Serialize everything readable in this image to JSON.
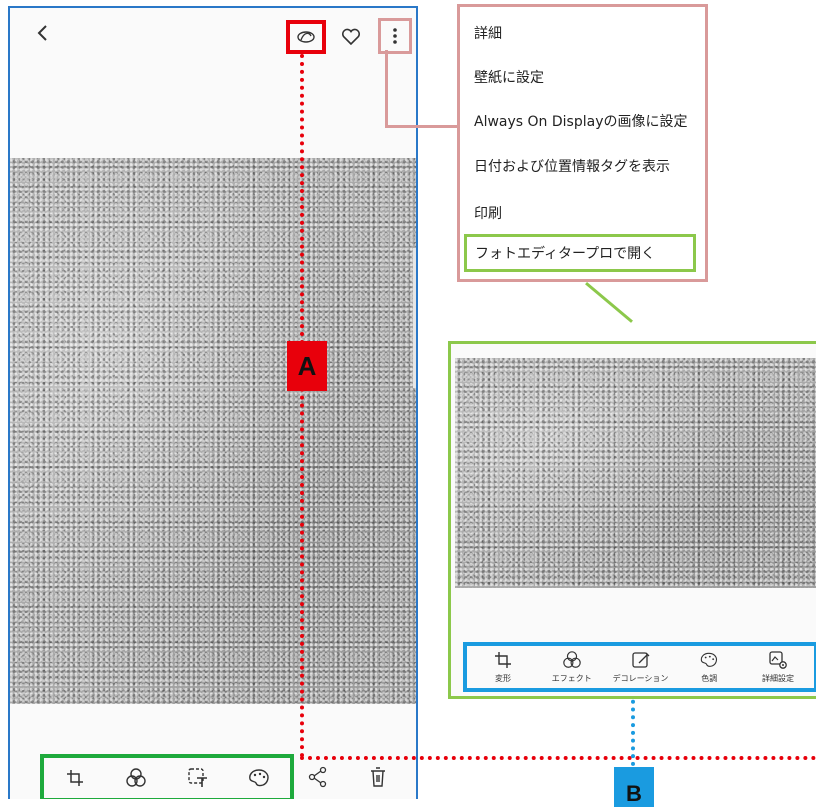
{
  "callouts": {
    "a": "A",
    "b": "B"
  },
  "menu": {
    "items": [
      "詳細",
      "壁紙に設定",
      "Always On Displayの画像に設定",
      "日付および位置情報タグを表示",
      "印刷",
      "フォトエディタープロで開く"
    ]
  },
  "editor": {
    "tools": [
      "変形",
      "エフェクト",
      "デコレーション",
      "色調",
      "詳細設定"
    ]
  },
  "colors": {
    "callout_a": "#e8000b",
    "callout_b": "#1a9be0",
    "menu_border": "#d99a9a",
    "highlight_green": "#8cc84b",
    "toolbar_green": "#1eaa3c",
    "phone_border": "#2a78c8"
  },
  "icons": {
    "top": [
      "back-icon",
      "remaster-icon",
      "heart-icon",
      "more-vertical-icon"
    ],
    "bottom": [
      "crop-rotate-icon",
      "effects-icon",
      "decoration-icon",
      "color-palette-icon",
      "share-icon",
      "trash-icon"
    ]
  }
}
